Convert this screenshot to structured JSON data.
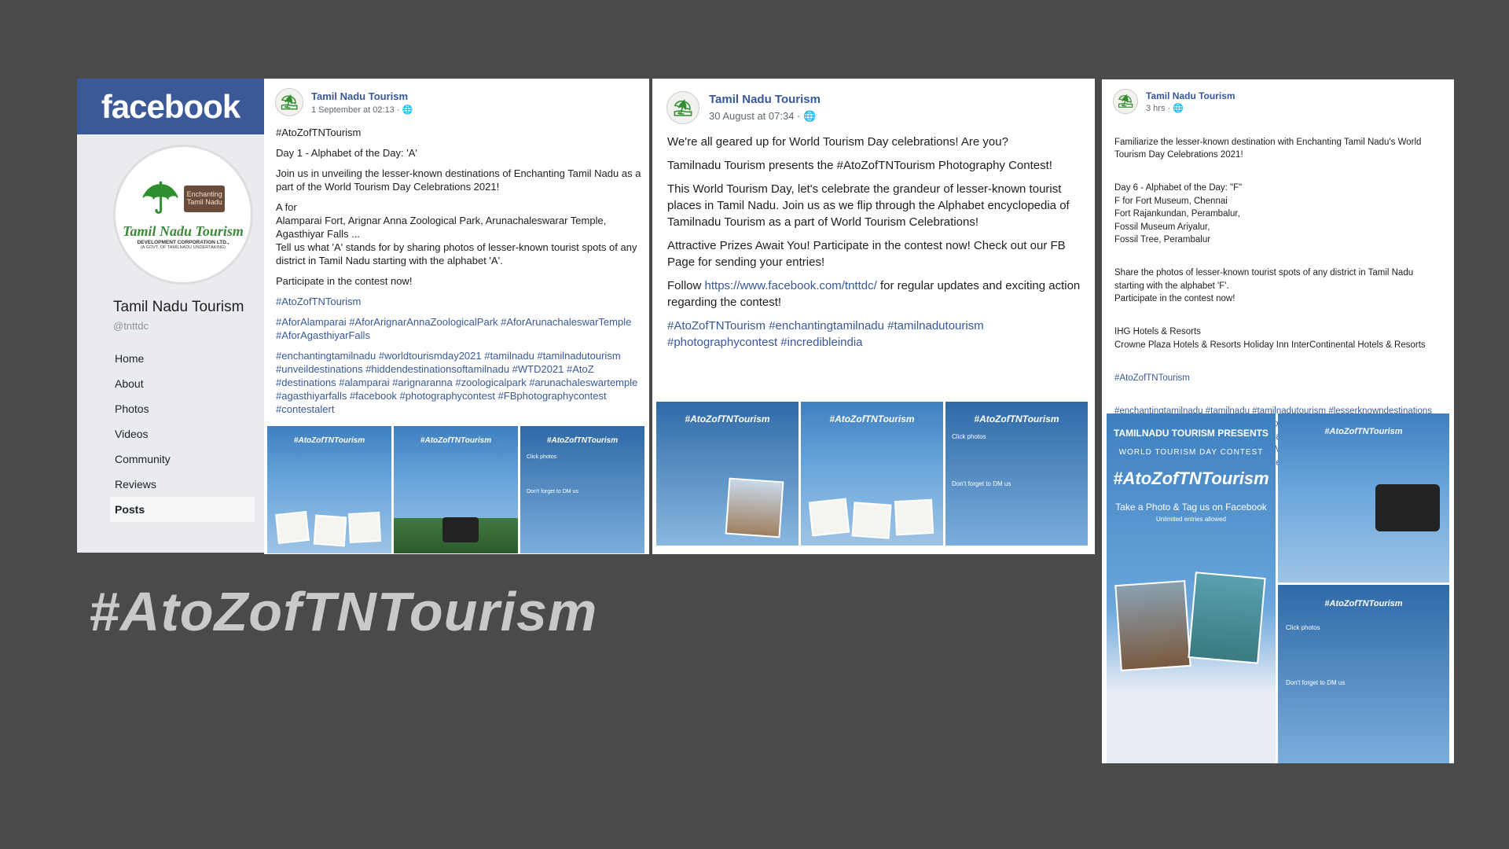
{
  "fb_sidebar": {
    "brand": "facebook",
    "logo": {
      "name": "Tamil Nadu Tourism",
      "sub": "DEVELOPMENT CORPORATION LTD.,",
      "sub2": "(A GOVT. OF TAMILNADU UNDERTAKING)",
      "badge": "Enchanting Tamil Nadu"
    },
    "page_name": "Tamil Nadu Tourism",
    "handle": "@tnttdc",
    "nav": [
      "Home",
      "About",
      "Photos",
      "Videos",
      "Community",
      "Reviews",
      "Posts"
    ]
  },
  "post1": {
    "name": "Tamil Nadu Tourism",
    "date": "1 September at 02:13 ·",
    "paragraphs": [
      "#AtoZofTNTourism",
      "Day 1 - Alphabet of the Day: 'A'",
      "Join us in unveiling the lesser-known destinations of Enchanting Tamil Nadu as a part of the World Tourism Day Celebrations 2021!",
      "A for",
      "Alamparai Fort, Arignar Anna Zoological Park, Arunachaleswarar Temple, Agasthiyar Falls ...",
      "Tell us what 'A' stands for by sharing photos of lesser-known tourist spots of any district in Tamil Nadu starting with the alphabet 'A'.",
      "Participate in the contest now!"
    ],
    "tags": [
      "#AtoZofTNTourism",
      "#AforAlamparai #AforArignarAnnaZoologicalPark #AforArunachaleswarTemple #AforAgasthiyarFalls",
      "#enchantingtamilnadu #worldtourismday2021 #tamilnadu #tamilnadutourism #unveildestinations #hiddendestinationsoftamilnadu #WTD2021 #AtoZ #destinations #alamparai #arignaranna #zoologicalpark #arunachaleswartemple #agasthiyarfalls #facebook #photographycontest #FBphotographycontest #contestalert"
    ]
  },
  "post2": {
    "name": "Tamil Nadu Tourism",
    "date": "30 August at 07:34 ·",
    "paragraphs": [
      "We're all geared up for World Tourism Day celebrations! Are you?",
      "Tamilnadu Tourism presents the #AtoZofTNTourism Photography Contest!",
      "This World Tourism Day, let's celebrate the grandeur of lesser-known tourist places in Tamil Nadu. Join us as we flip through the Alphabet encyclopedia of Tamilnadu Tourism as a part of World Tourism Celebrations!",
      "Attractive Prizes Await You! Participate in the contest now! Check out our FB Page for sending your entries!"
    ],
    "follow_pre": "Follow ",
    "follow_link": "https://www.facebook.com/tnttdc/",
    "follow_post": " for regular updates and exciting action regarding the contest!",
    "tags": "#AtoZofTNTourism #enchantingtamilnadu #tamilnadutourism #photographycontest #incredibleindia"
  },
  "post3": {
    "name": "Tamil Nadu Tourism",
    "date": "3 hrs ·",
    "paragraphs": [
      "Familiarize the lesser-known destination with Enchanting Tamil Nadu's World Tourism Day Celebrations 2021!",
      "Day 6 - Alphabet of the Day: \"F\"\nF for Fort Museum, Chennai\nFort Rajankundan, Perambalur,\nFossil Museum Ariyalur,\nFossil Tree, Perambalur",
      "Share the photos of lesser-known tourist spots of any district in Tamil Nadu starting with the alphabet 'F'.\nParticipate in the contest now!",
      "IHG Hotels & Resorts\nCrowne Plaza Hotels & Resorts Holiday Inn InterContinental Hotels & Resorts"
    ],
    "tags": [
      "#AtoZofTNTourism",
      "#enchantingtamilnadu #tamilnadu #tamilnadutourism #lesserknowndestinations #hiddendestinationsoftamilnadu #worldtourismday2021 #WTD2021 #AtoZ #destinations #letterF #letteroftheday #day6 #FforFortMuseum #Chennai #FortRajankundan #Perambalur #FossilMuseum #Ariyalur #FossilTree #photography #tamilnadutravellers #travelgram #incredibleindia #india"
    ]
  },
  "tile_titles": {
    "hashtag": "#AtoZofTNTourism",
    "presents": "TAMILNADU TOURISM PRESENTS",
    "contest": "WORLD TOURISM DAY CONTEST",
    "take_photo": "Take a Photo & Tag us on Facebook",
    "unlimited": "Unlimited entries allowed",
    "click_photos": "Click photos",
    "dont_forget": "Don't forget to DM us"
  },
  "big_title": "#AtoZofTNTourism"
}
